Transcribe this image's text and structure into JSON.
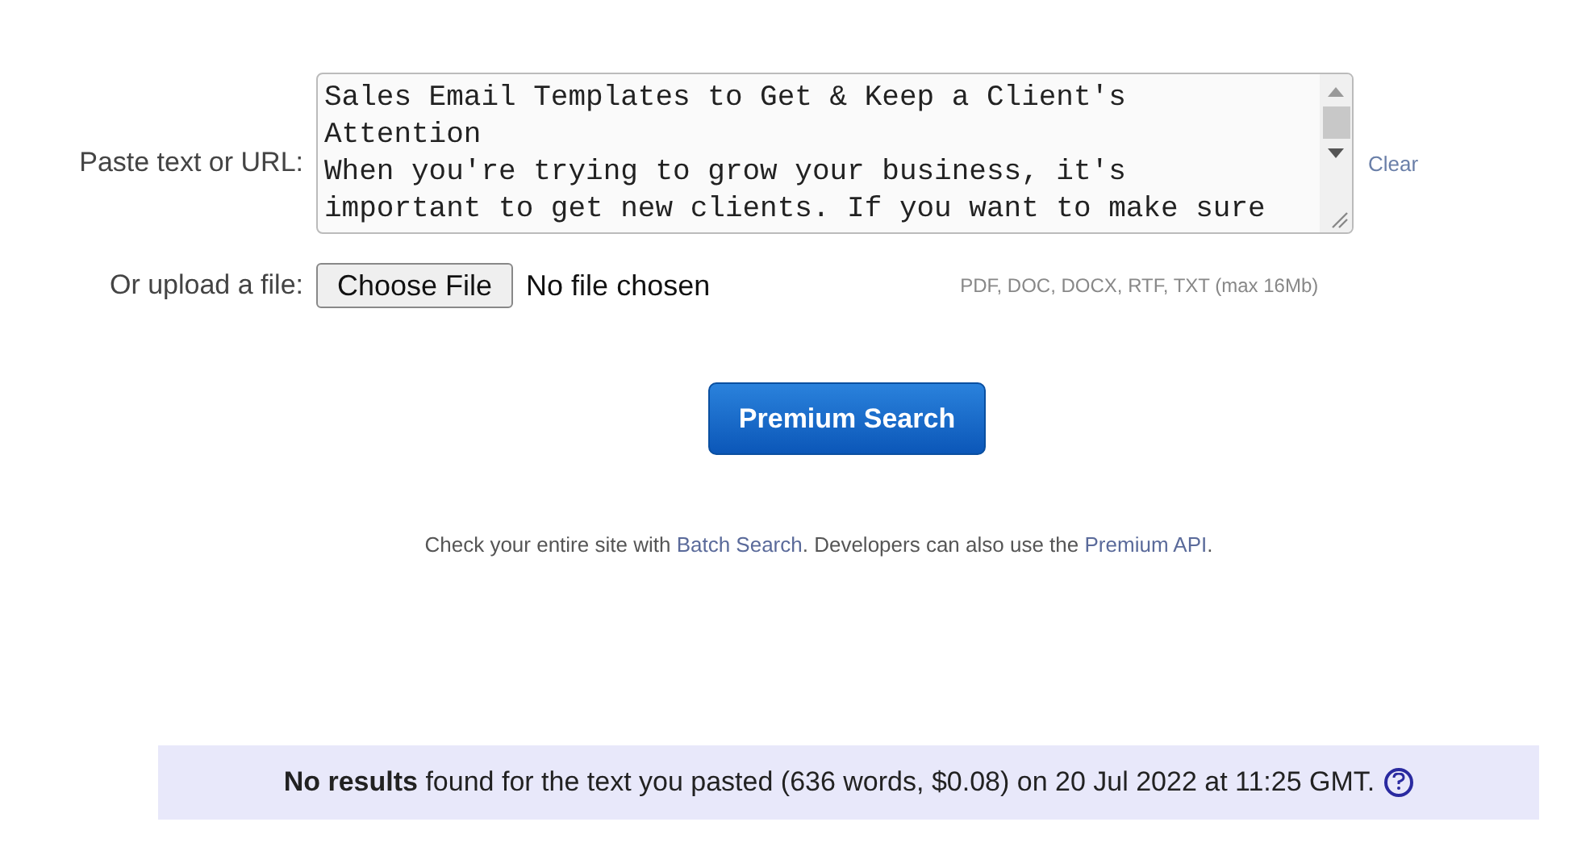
{
  "paste": {
    "label": "Paste text or URL:",
    "value": "Sales Email Templates to Get & Keep a Client's Attention\nWhen you're trying to grow your business, it's important to get new clients. If you want to make sure",
    "clear": "Clear"
  },
  "upload": {
    "label": "Or upload a file:",
    "button": "Choose File",
    "status": "No file chosen",
    "hint": "PDF, DOC, DOCX, RTF, TXT (max 16Mb)"
  },
  "search_button": "Premium Search",
  "note": [
    {
      "kind": "text",
      "text": "Check your entire site with"
    },
    {
      "kind": "link",
      "text": "Batch Search"
    },
    {
      "kind": "text",
      "text": ". Developers can also use the"
    },
    {
      "kind": "link",
      "text": "Premium API"
    },
    {
      "kind": "text",
      "text": "."
    }
  ],
  "result": {
    "bold": "No results",
    "text": "found for the text you pasted (636 words, $0.08) on 20 Jul 2022 at 11:25 GMT."
  }
}
